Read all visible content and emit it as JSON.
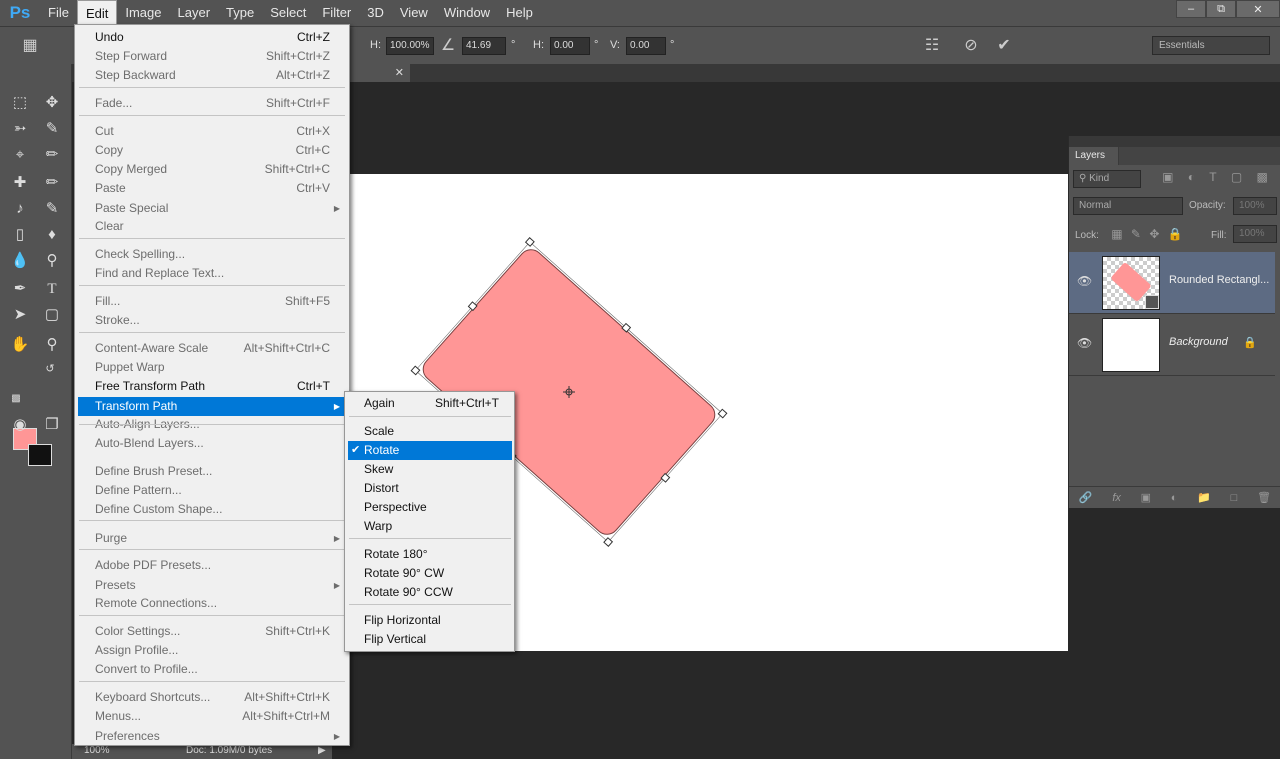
{
  "app": {
    "logo": "Ps",
    "menu": [
      "File",
      "Edit",
      "Image",
      "Layer",
      "Type",
      "Select",
      "Filter",
      "3D",
      "View",
      "Window",
      "Help"
    ],
    "window_controls": [
      "‒",
      "⧉",
      "✕"
    ]
  },
  "options": {
    "h_label": "H:",
    "h_value": "100.00%",
    "angle_value": "41.69",
    "deg": "°",
    "hskew_label": "H:",
    "hskew_value": "0.00",
    "vskew_label": "V:",
    "vskew_value": "0.00",
    "workspace": "Essentials"
  },
  "status": {
    "zoom": "100%",
    "doc": "Doc: 1.09M/0 bytes"
  },
  "colors": {
    "foreground": "#ff9696",
    "background": "#111111",
    "highlight": "#0078d7",
    "shape_fill": "#ff9696"
  },
  "edit_menu": {
    "items": [
      {
        "label": "Undo",
        "shortcut": "Ctrl+Z",
        "enabled": true
      },
      {
        "label": "Step Forward",
        "shortcut": "Shift+Ctrl+Z",
        "enabled": false
      },
      {
        "label": "Step Backward",
        "shortcut": "Alt+Ctrl+Z",
        "enabled": false
      },
      {
        "label": "Fade...",
        "shortcut": "Shift+Ctrl+F",
        "enabled": false
      },
      {
        "label": "Cut",
        "shortcut": "Ctrl+X",
        "enabled": false
      },
      {
        "label": "Copy",
        "shortcut": "Ctrl+C",
        "enabled": false
      },
      {
        "label": "Copy Merged",
        "shortcut": "Shift+Ctrl+C",
        "enabled": false
      },
      {
        "label": "Paste",
        "shortcut": "Ctrl+V",
        "enabled": false
      },
      {
        "label": "Paste Special",
        "shortcut": "",
        "enabled": false,
        "submenu": true
      },
      {
        "label": "Clear",
        "shortcut": "",
        "enabled": false
      },
      {
        "label": "Check Spelling...",
        "shortcut": "",
        "enabled": false
      },
      {
        "label": "Find and Replace Text...",
        "shortcut": "",
        "enabled": false
      },
      {
        "label": "Fill...",
        "shortcut": "Shift+F5",
        "enabled": false
      },
      {
        "label": "Stroke...",
        "shortcut": "",
        "enabled": false
      },
      {
        "label": "Content-Aware Scale",
        "shortcut": "Alt+Shift+Ctrl+C",
        "enabled": false
      },
      {
        "label": "Puppet Warp",
        "shortcut": "",
        "enabled": false
      },
      {
        "label": "Free Transform Path",
        "shortcut": "Ctrl+T",
        "enabled": true
      },
      {
        "label": "Transform Path",
        "shortcut": "",
        "enabled": true,
        "submenu": true,
        "highlighted": true
      },
      {
        "label": "Auto-Align Layers...",
        "shortcut": "",
        "enabled": false
      },
      {
        "label": "Auto-Blend Layers...",
        "shortcut": "",
        "enabled": false
      },
      {
        "label": "Define Brush Preset...",
        "shortcut": "",
        "enabled": false
      },
      {
        "label": "Define Pattern...",
        "shortcut": "",
        "enabled": false
      },
      {
        "label": "Define Custom Shape...",
        "shortcut": "",
        "enabled": false
      },
      {
        "label": "Purge",
        "shortcut": "",
        "enabled": false,
        "submenu": true
      },
      {
        "label": "Adobe PDF Presets...",
        "shortcut": "",
        "enabled": false
      },
      {
        "label": "Presets",
        "shortcut": "",
        "enabled": false,
        "submenu": true
      },
      {
        "label": "Remote Connections...",
        "shortcut": "",
        "enabled": false
      },
      {
        "label": "Color Settings...",
        "shortcut": "Shift+Ctrl+K",
        "enabled": false
      },
      {
        "label": "Assign Profile...",
        "shortcut": "",
        "enabled": false
      },
      {
        "label": "Convert to Profile...",
        "shortcut": "",
        "enabled": false
      },
      {
        "label": "Keyboard Shortcuts...",
        "shortcut": "Alt+Shift+Ctrl+K",
        "enabled": false
      },
      {
        "label": "Menus...",
        "shortcut": "Alt+Shift+Ctrl+M",
        "enabled": false
      },
      {
        "label": "Preferences",
        "shortcut": "",
        "enabled": false,
        "submenu": true
      }
    ]
  },
  "transform_menu": {
    "items": [
      {
        "label": "Again",
        "shortcut": "Shift+Ctrl+T"
      },
      {
        "label": "Scale",
        "shortcut": ""
      },
      {
        "label": "Rotate",
        "shortcut": "",
        "checked": true,
        "highlighted": true
      },
      {
        "label": "Skew",
        "shortcut": ""
      },
      {
        "label": "Distort",
        "shortcut": ""
      },
      {
        "label": "Perspective",
        "shortcut": ""
      },
      {
        "label": "Warp",
        "shortcut": ""
      },
      {
        "label": "Rotate 180°",
        "shortcut": ""
      },
      {
        "label": "Rotate 90° CW",
        "shortcut": ""
      },
      {
        "label": "Rotate 90° CCW",
        "shortcut": ""
      },
      {
        "label": "Flip Horizontal",
        "shortcut": ""
      },
      {
        "label": "Flip Vertical",
        "shortcut": ""
      }
    ]
  },
  "layers": {
    "tab": "Layers",
    "kind": "Kind",
    "blend_mode": "Normal",
    "opacity_label": "Opacity:",
    "opacity_value": "100%",
    "lock_label": "Lock:",
    "fill_label": "Fill:",
    "fill_value": "100%",
    "items": [
      {
        "name": "Rounded Rectangl...",
        "selected": true
      },
      {
        "name": "Background",
        "selected": false,
        "locked": true
      }
    ]
  }
}
